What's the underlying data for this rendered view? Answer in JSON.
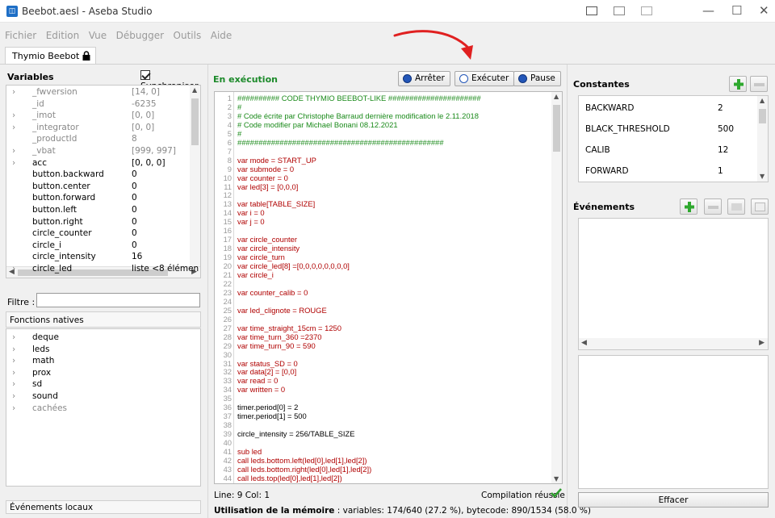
{
  "window": {
    "title": "Beebot.aesl - Aseba Studio",
    "icon": "aseba-icon"
  },
  "menu": [
    "Fichier",
    "Edition",
    "Vue",
    "Débugger",
    "Outils",
    "Aide"
  ],
  "tab": {
    "label": "Thymio Beebot",
    "icon": "lock-icon"
  },
  "variables": {
    "title": "Variables",
    "sync_label": "Synchroniser",
    "rows": [
      {
        "name": "_fwversion",
        "value": "[14, 0]",
        "expandable": true,
        "muted": true
      },
      {
        "name": "_id",
        "value": "-6235",
        "expandable": false,
        "muted": true
      },
      {
        "name": "_imot",
        "value": "[0, 0]",
        "expandable": true,
        "muted": true
      },
      {
        "name": "_integrator",
        "value": "[0, 0]",
        "expandable": true,
        "muted": true
      },
      {
        "name": "_productId",
        "value": "8",
        "expandable": false,
        "muted": true
      },
      {
        "name": "_vbat",
        "value": "[999, 997]",
        "expandable": true,
        "muted": true
      },
      {
        "name": "acc",
        "value": "[0, 0, 0]",
        "expandable": true,
        "muted": false
      },
      {
        "name": "button.backward",
        "value": "0",
        "expandable": false,
        "muted": false
      },
      {
        "name": "button.center",
        "value": "0",
        "expandable": false,
        "muted": false
      },
      {
        "name": "button.forward",
        "value": "0",
        "expandable": false,
        "muted": false
      },
      {
        "name": "button.left",
        "value": "0",
        "expandable": false,
        "muted": false
      },
      {
        "name": "button.right",
        "value": "0",
        "expandable": false,
        "muted": false
      },
      {
        "name": "circle_counter",
        "value": "0",
        "expandable": false,
        "muted": false
      },
      {
        "name": "circle_i",
        "value": "0",
        "expandable": false,
        "muted": false
      },
      {
        "name": "circle_intensity",
        "value": "16",
        "expandable": false,
        "muted": false
      },
      {
        "name": "circle_led",
        "value": "liste <8 élémen",
        "expandable": true,
        "muted": false
      }
    ]
  },
  "filter": {
    "label": "Filtre :",
    "value": ""
  },
  "native": {
    "title": "Fonctions natives",
    "items": [
      {
        "name": "deque",
        "muted": false
      },
      {
        "name": "leds",
        "muted": false
      },
      {
        "name": "math",
        "muted": false
      },
      {
        "name": "prox",
        "muted": false
      },
      {
        "name": "sd",
        "muted": false
      },
      {
        "name": "sound",
        "muted": false
      },
      {
        "name": "cachées",
        "muted": true
      }
    ]
  },
  "local_events_label": "Événements locaux",
  "editor": {
    "status": "En exécution",
    "buttons": {
      "stop": "Arrêter",
      "run": "Exécuter",
      "pause": "Pause"
    },
    "lines": [
      {
        "n": "1",
        "text": "########## CODE THYMIO BEEBOT-LIKE ######################",
        "color": "green"
      },
      {
        "n": "2",
        "text": "#",
        "color": "green"
      },
      {
        "n": "3",
        "text": "# Code écrite par Christophe Barraud dernière modification le 2.11.2018",
        "color": "green"
      },
      {
        "n": "4",
        "text": "# Code modifier par Michael Bonani 08.12.2021",
        "color": "green"
      },
      {
        "n": "5",
        "text": "#",
        "color": "green"
      },
      {
        "n": "6",
        "text": "#################################################",
        "color": "green"
      },
      {
        "n": "7",
        "text": "",
        "color": "black"
      },
      {
        "n": "8",
        "text": "var mode = START_UP",
        "color": "red"
      },
      {
        "n": "9",
        "text": "var submode = 0",
        "color": "red"
      },
      {
        "n": "10",
        "text": "var counter = 0",
        "color": "red"
      },
      {
        "n": "11",
        "text": "var led[3] = [0,0,0]",
        "color": "red"
      },
      {
        "n": "12",
        "text": "",
        "color": "black"
      },
      {
        "n": "13",
        "text": "var table[TABLE_SIZE]",
        "color": "red"
      },
      {
        "n": "14",
        "text": "var i = 0",
        "color": "red"
      },
      {
        "n": "15",
        "text": "var j = 0",
        "color": "red"
      },
      {
        "n": "16",
        "text": "",
        "color": "black"
      },
      {
        "n": "17",
        "text": "var circle_counter",
        "color": "red"
      },
      {
        "n": "18",
        "text": "var circle_intensity",
        "color": "red"
      },
      {
        "n": "19",
        "text": "var circle_turn",
        "color": "red"
      },
      {
        "n": "20",
        "text": "var circle_led[8] =[0,0,0,0,0,0,0,0]",
        "color": "red"
      },
      {
        "n": "21",
        "text": "var circle_i",
        "color": "red"
      },
      {
        "n": "22",
        "text": "",
        "color": "black"
      },
      {
        "n": "23",
        "text": "var counter_calib = 0",
        "color": "red"
      },
      {
        "n": "24",
        "text": "",
        "color": "black"
      },
      {
        "n": "25",
        "text": "var led_clignote = ROUGE",
        "color": "red"
      },
      {
        "n": "26",
        "text": "",
        "color": "black"
      },
      {
        "n": "27",
        "text": "var time_straight_15cm = 1250",
        "color": "red"
      },
      {
        "n": "28",
        "text": "var time_turn_360 =2370",
        "color": "red"
      },
      {
        "n": "29",
        "text": "var time_turn_90 = 590",
        "color": "red"
      },
      {
        "n": "30",
        "text": "",
        "color": "black"
      },
      {
        "n": "31",
        "text": "var status_SD = 0",
        "color": "red"
      },
      {
        "n": "32",
        "text": "var data[2] = [0,0]",
        "color": "red"
      },
      {
        "n": "33",
        "text": "var read = 0",
        "color": "red"
      },
      {
        "n": "34",
        "text": "var written = 0",
        "color": "red"
      },
      {
        "n": "35",
        "text": "",
        "color": "black"
      },
      {
        "n": "36",
        "text": "timer.period[0] = 2",
        "color": "black"
      },
      {
        "n": "37",
        "text": "timer.period[1] = 500",
        "color": "black"
      },
      {
        "n": "38",
        "text": "",
        "color": "black"
      },
      {
        "n": "39",
        "text": "circle_intensity = 256/TABLE_SIZE",
        "color": "black"
      },
      {
        "n": "40",
        "text": "",
        "color": "black"
      },
      {
        "n": "41",
        "text": "sub led",
        "color": "red"
      },
      {
        "n": "42",
        "text": "call leds.bottom.left(led[0],led[1],led[2])",
        "color": "red"
      },
      {
        "n": "43",
        "text": "call leds.bottom.right(led[0],led[1],led[2])",
        "color": "red"
      },
      {
        "n": "44",
        "text": "call leds.top(led[0],led[1],led[2])",
        "color": "red"
      }
    ],
    "cursor": "Line: 9 Col: 1",
    "compile_status": "Compilation réussie",
    "memory_label": "Utilisation de la mémoire",
    "memory_value": " : variables: 174/640 (27.2 %), bytecode: 890/1534 (58.0 %)"
  },
  "constants": {
    "title": "Constantes",
    "rows": [
      {
        "name": "BACKWARD",
        "value": "2"
      },
      {
        "name": "BLACK_THRESHOLD",
        "value": "500"
      },
      {
        "name": "CALIB",
        "value": "12"
      },
      {
        "name": "FORWARD",
        "value": "1"
      }
    ]
  },
  "events": {
    "title": "Événements",
    "clear_label": "Effacer"
  },
  "colors": {
    "green": "#1a8a1a",
    "red": "#b00000",
    "accent_blue": "#2356b8",
    "annotation": "#e02020"
  }
}
